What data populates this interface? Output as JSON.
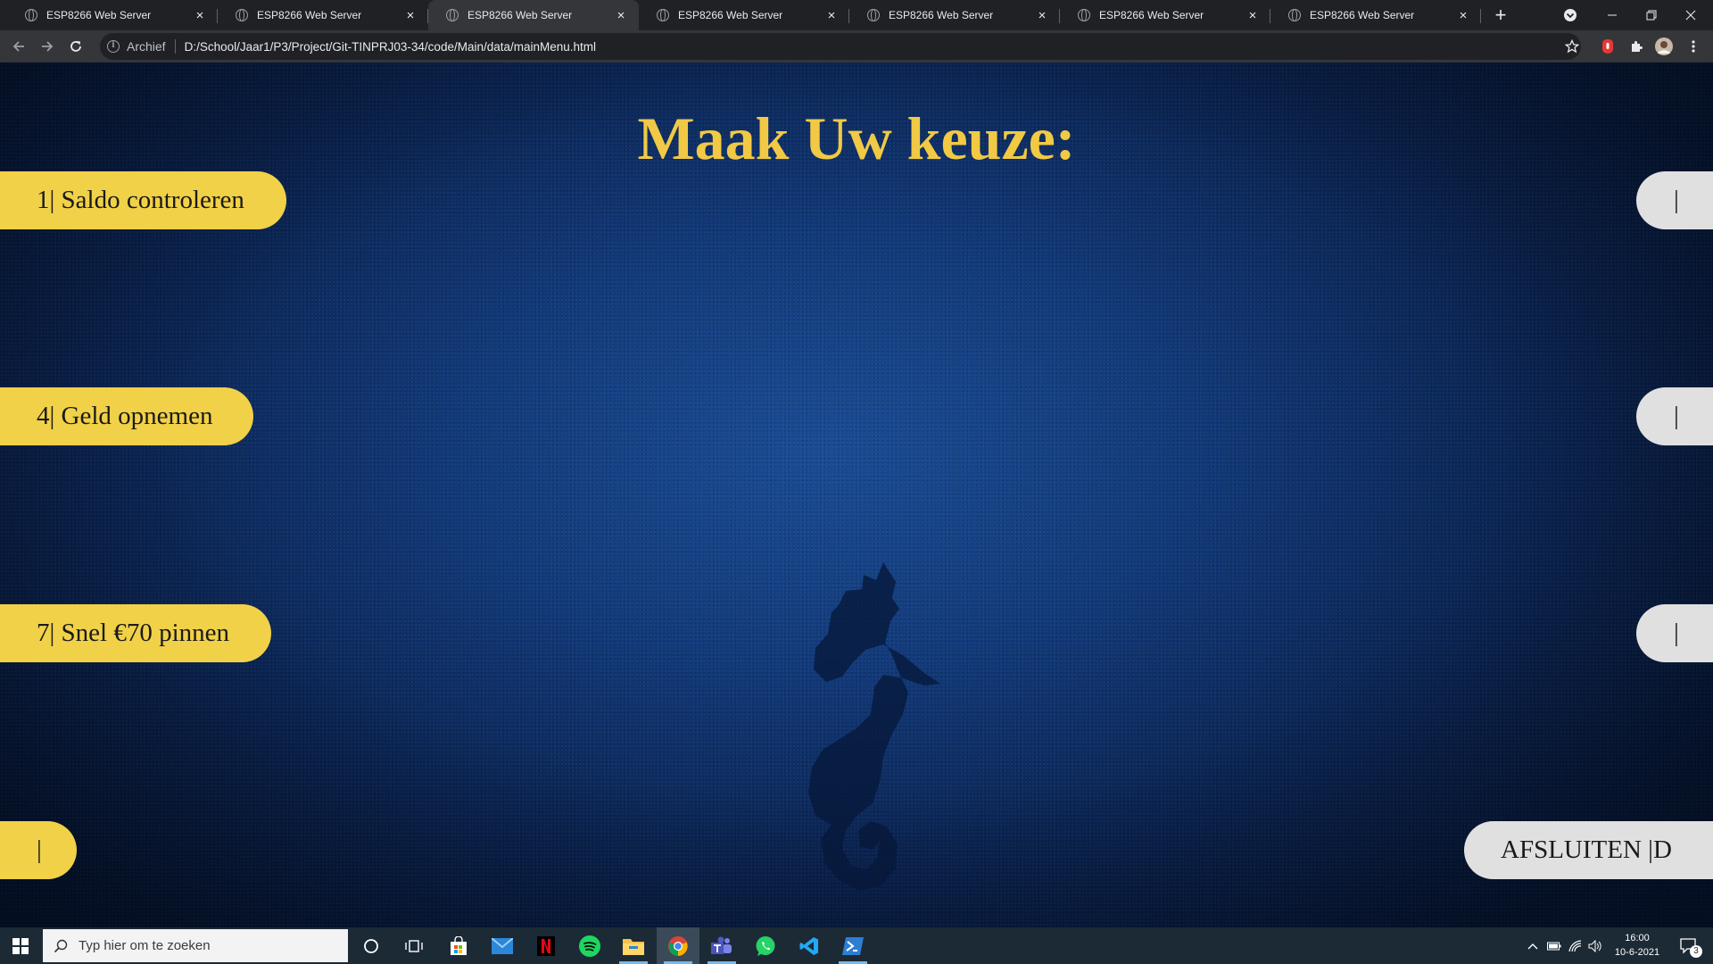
{
  "browser": {
    "tabs": [
      {
        "title": "ESP8266 Web Server",
        "active": false
      },
      {
        "title": "ESP8266 Web Server",
        "active": false
      },
      {
        "title": "ESP8266 Web Server",
        "active": true
      },
      {
        "title": "ESP8266 Web Server",
        "active": false
      },
      {
        "title": "ESP8266 Web Server",
        "active": false
      },
      {
        "title": "ESP8266 Web Server",
        "active": false
      },
      {
        "title": "ESP8266 Web Server",
        "active": false
      }
    ],
    "tab_close_glyph": "×",
    "new_tab_glyph": "+",
    "address_chip": "Archief",
    "url": "D:/School/Jaar1/P3/Project/Git-TINPRJ03-34/code/Main/data/mainMenu.html"
  },
  "page": {
    "title": "Maak Uw keuze:",
    "left_buttons": [
      {
        "label": "1| Saldo controleren"
      },
      {
        "label": "4| Geld opnemen"
      },
      {
        "label": "7| Snel €70 pinnen"
      },
      {
        "label": "|"
      }
    ],
    "right_buttons": [
      {
        "label": "|"
      },
      {
        "label": "|"
      },
      {
        "label": "|"
      },
      {
        "label": "AFSLUITEN |D"
      }
    ],
    "colors": {
      "accent_yellow": "#f1c945",
      "button_yellow": "#f1d147",
      "button_gray": "#e0e0e0"
    }
  },
  "taskbar": {
    "search_placeholder": "Typ hier om te zoeken",
    "time": "16:00",
    "date": "10-6-2021",
    "notification_count": "3",
    "apps": [
      "cortana-icon",
      "task-view-icon",
      "store-icon",
      "mail-icon",
      "netflix-icon",
      "spotify-icon",
      "file-explorer-icon",
      "chrome-icon",
      "teams-icon",
      "whatsapp-icon",
      "vscode-icon",
      "powershell-icon"
    ]
  }
}
